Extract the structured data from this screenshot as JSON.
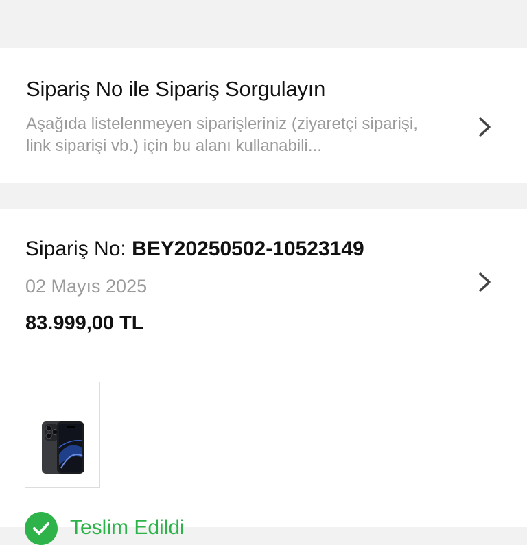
{
  "query_section": {
    "title": "Sipariş No ile Sipariş Sorgulayın",
    "description": "Aşağıda listelenmeyen siparişleriniz (ziyaretçi siparişi, link siparişi vb.) için bu alanı kullanabili...",
    "chevron_icon": "chevron-right-icon"
  },
  "order": {
    "number_label": "Sipariş No:",
    "number_value": "BEY20250502-10523149",
    "date": "02 Mayıs 2025",
    "total": "83.999,00 TL",
    "chevron_icon": "chevron-right-icon",
    "product_image_icon": "smartphone-icon",
    "status_icon": "check-circle-icon",
    "status_text": "Teslim Edildi",
    "status_color": "#2db34a"
  }
}
